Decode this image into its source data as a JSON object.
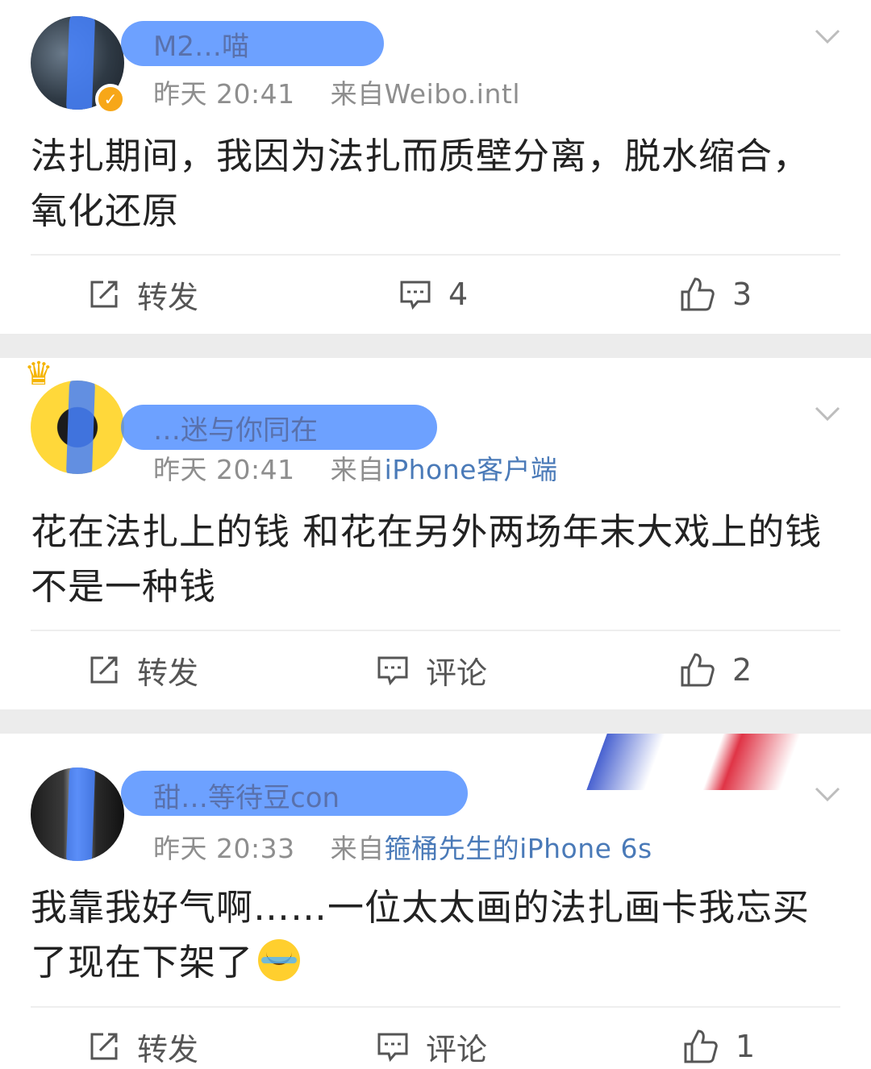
{
  "posts": [
    {
      "name": "M2…喵",
      "time": "昨天 20:41",
      "source_prefix": "来自",
      "source": "Weibo.intl",
      "source_linked": false,
      "content": "法扎期间，我因为法扎而质壁分离，脱水缩合，氧化还原",
      "actions": {
        "repost": "转发",
        "comment": "4",
        "like": "3"
      }
    },
    {
      "name": "…迷与你同在",
      "time": "昨天 20:41",
      "source_prefix": "来自",
      "source": "iPhone客户端",
      "source_linked": true,
      "content": "花在法扎上的钱 和花在另外两场年末大戏上的钱 不是一种钱",
      "actions": {
        "repost": "转发",
        "comment": "评论",
        "like": "2"
      }
    },
    {
      "name": "甜…等待豆con",
      "time": "昨天 20:33",
      "source_prefix": "来自",
      "source": "箍桶先生的iPhone 6s",
      "source_linked": true,
      "content": "我靠我好气啊……一位太太画的法扎画卡我忘买了现在下架了",
      "actions": {
        "repost": "转发",
        "comment": "评论",
        "like": "1"
      }
    }
  ],
  "icons": {
    "repost": "repost-icon",
    "comment": "comment-icon",
    "like": "thumbs-up-icon",
    "more": "chevron-down-icon",
    "verified": "verified-badge-icon"
  },
  "colors": {
    "link": "#4a7ab8",
    "meta": "#8e8e8e",
    "separator": "#ececec",
    "redaction": "#3c82ff"
  }
}
